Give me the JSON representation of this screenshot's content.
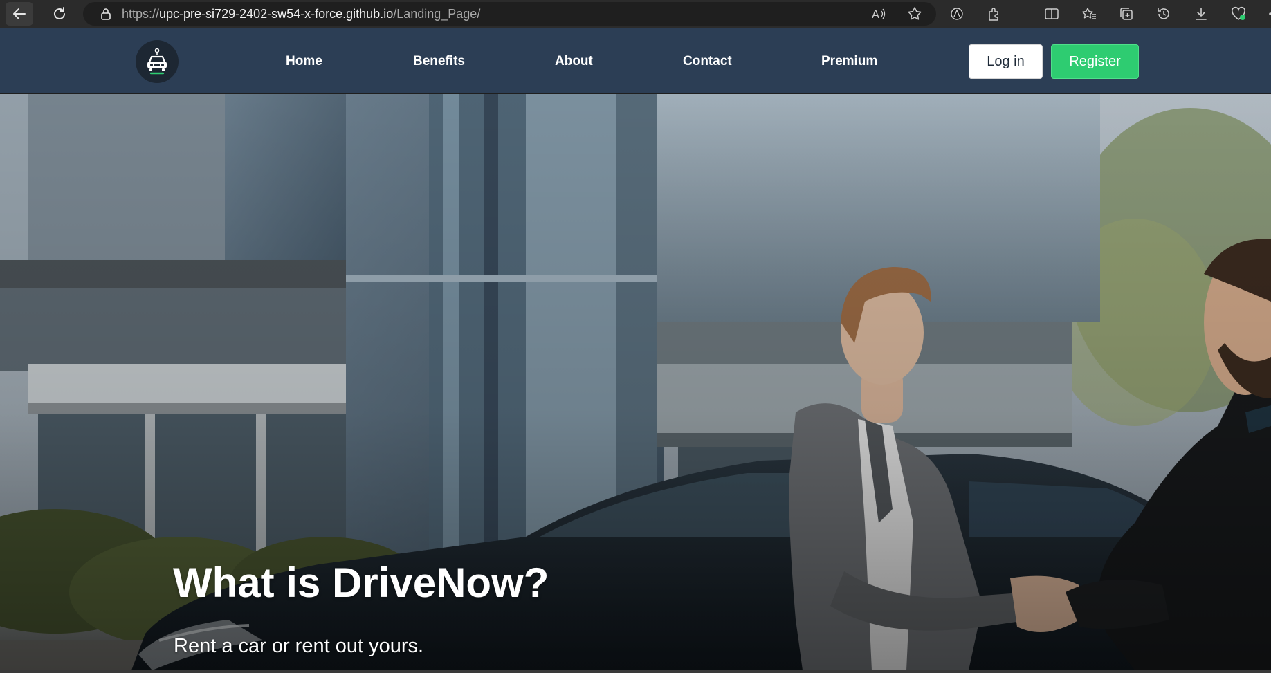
{
  "browser": {
    "url_scheme": "https://",
    "url_host": "upc-pre-si729-2402-sw54-x-force.github.io",
    "url_path": "/Landing_Page/",
    "icons": [
      "back-arrow-icon",
      "reload-icon",
      "lock-icon",
      "read-aloud-icon",
      "favorite-star-icon",
      "browser-essentials-icon",
      "extensions-icon",
      "split-screen-icon",
      "favorites-icon",
      "collections-icon",
      "history-icon",
      "downloads-icon",
      "performance-icon",
      "more-menu-icon"
    ]
  },
  "navbar": {
    "logo_icon": "car-logo-icon",
    "links": [
      {
        "label": "Home"
      },
      {
        "label": "Benefits"
      },
      {
        "label": "About"
      },
      {
        "label": "Contact"
      },
      {
        "label": "Premium"
      }
    ],
    "login_label": "Log in",
    "register_label": "Register"
  },
  "hero": {
    "title": "What is DriveNow?",
    "subtitle": "Rent a car or rent out yours."
  },
  "colors": {
    "navbar_bg": "#2c3e55",
    "register_bg": "#2ecc71",
    "login_bg": "#ffffff",
    "browser_bg": "#2b2b2b"
  }
}
